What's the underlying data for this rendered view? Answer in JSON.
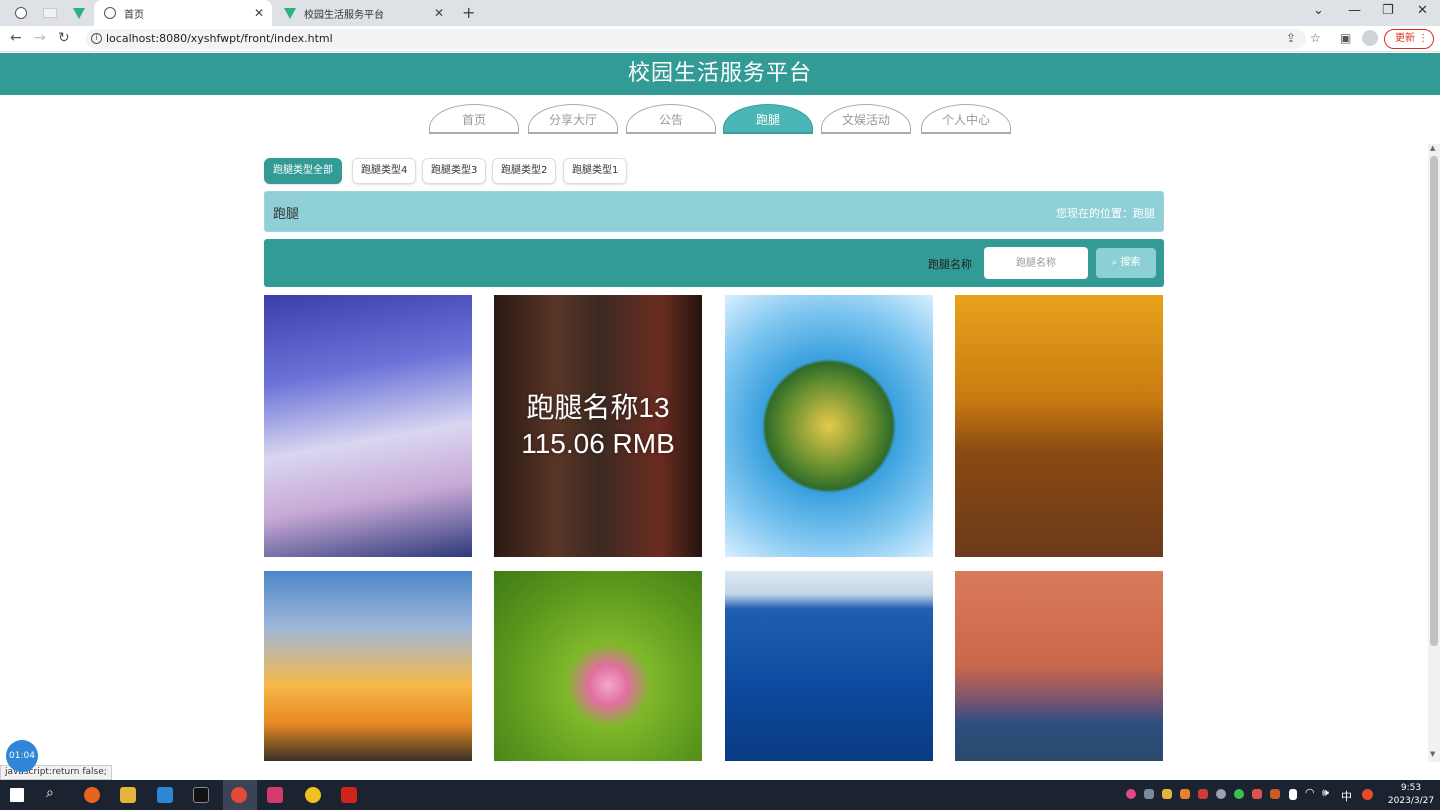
{
  "browser": {
    "tabs": [
      {
        "title": "",
        "icon": "globe-icon"
      },
      {
        "title": "",
        "icon": "blank-page-icon"
      },
      {
        "title": "",
        "icon": "vue-logo-icon"
      },
      {
        "title": "首页",
        "icon": "globe-icon",
        "active": true
      },
      {
        "title": "校园生活服务平台",
        "icon": "vue-logo-icon"
      }
    ],
    "url": "localhost:8080/xyshfwpt/front/index.html",
    "update_label": "更新"
  },
  "header": {
    "title": "校园生活服务平台"
  },
  "nav": {
    "items": [
      {
        "label": "首页"
      },
      {
        "label": "分享大厅"
      },
      {
        "label": "公告"
      },
      {
        "label": "跑腿",
        "active": true
      },
      {
        "label": "文娱活动"
      },
      {
        "label": "个人中心"
      }
    ]
  },
  "types": [
    {
      "label": "跑腿类型全部",
      "active": true
    },
    {
      "label": "跑腿类型4"
    },
    {
      "label": "跑腿类型3"
    },
    {
      "label": "跑腿类型2"
    },
    {
      "label": "跑腿类型1"
    }
  ],
  "crumb": {
    "title": "跑腿",
    "location": "您现在的位置：跑腿"
  },
  "search": {
    "label": "跑腿名称",
    "placeholder": "跑腿名称",
    "button": "搜索"
  },
  "cards": [
    {
      "image": "sky-clouds"
    },
    {
      "image": "temple-corridor",
      "name": "跑腿名称13",
      "price": "115.06 RMB"
    },
    {
      "image": "tiny-planet"
    },
    {
      "image": "autumn-avenue"
    },
    {
      "image": "sunset-rainbow"
    },
    {
      "image": "lotus-flower"
    },
    {
      "image": "blue-lake"
    },
    {
      "image": "moon-sunset"
    }
  ],
  "status_link": "javascript:return false;",
  "timer": "01:04",
  "taskbar": {
    "time": "9:53",
    "date": "2023/3/27",
    "ime": "中"
  },
  "colors": {
    "brand": "#329b96",
    "active_nav": "#4cb6b6",
    "crumb_bg": "#8ed0d6",
    "search_btn": "#8dd0d4"
  }
}
